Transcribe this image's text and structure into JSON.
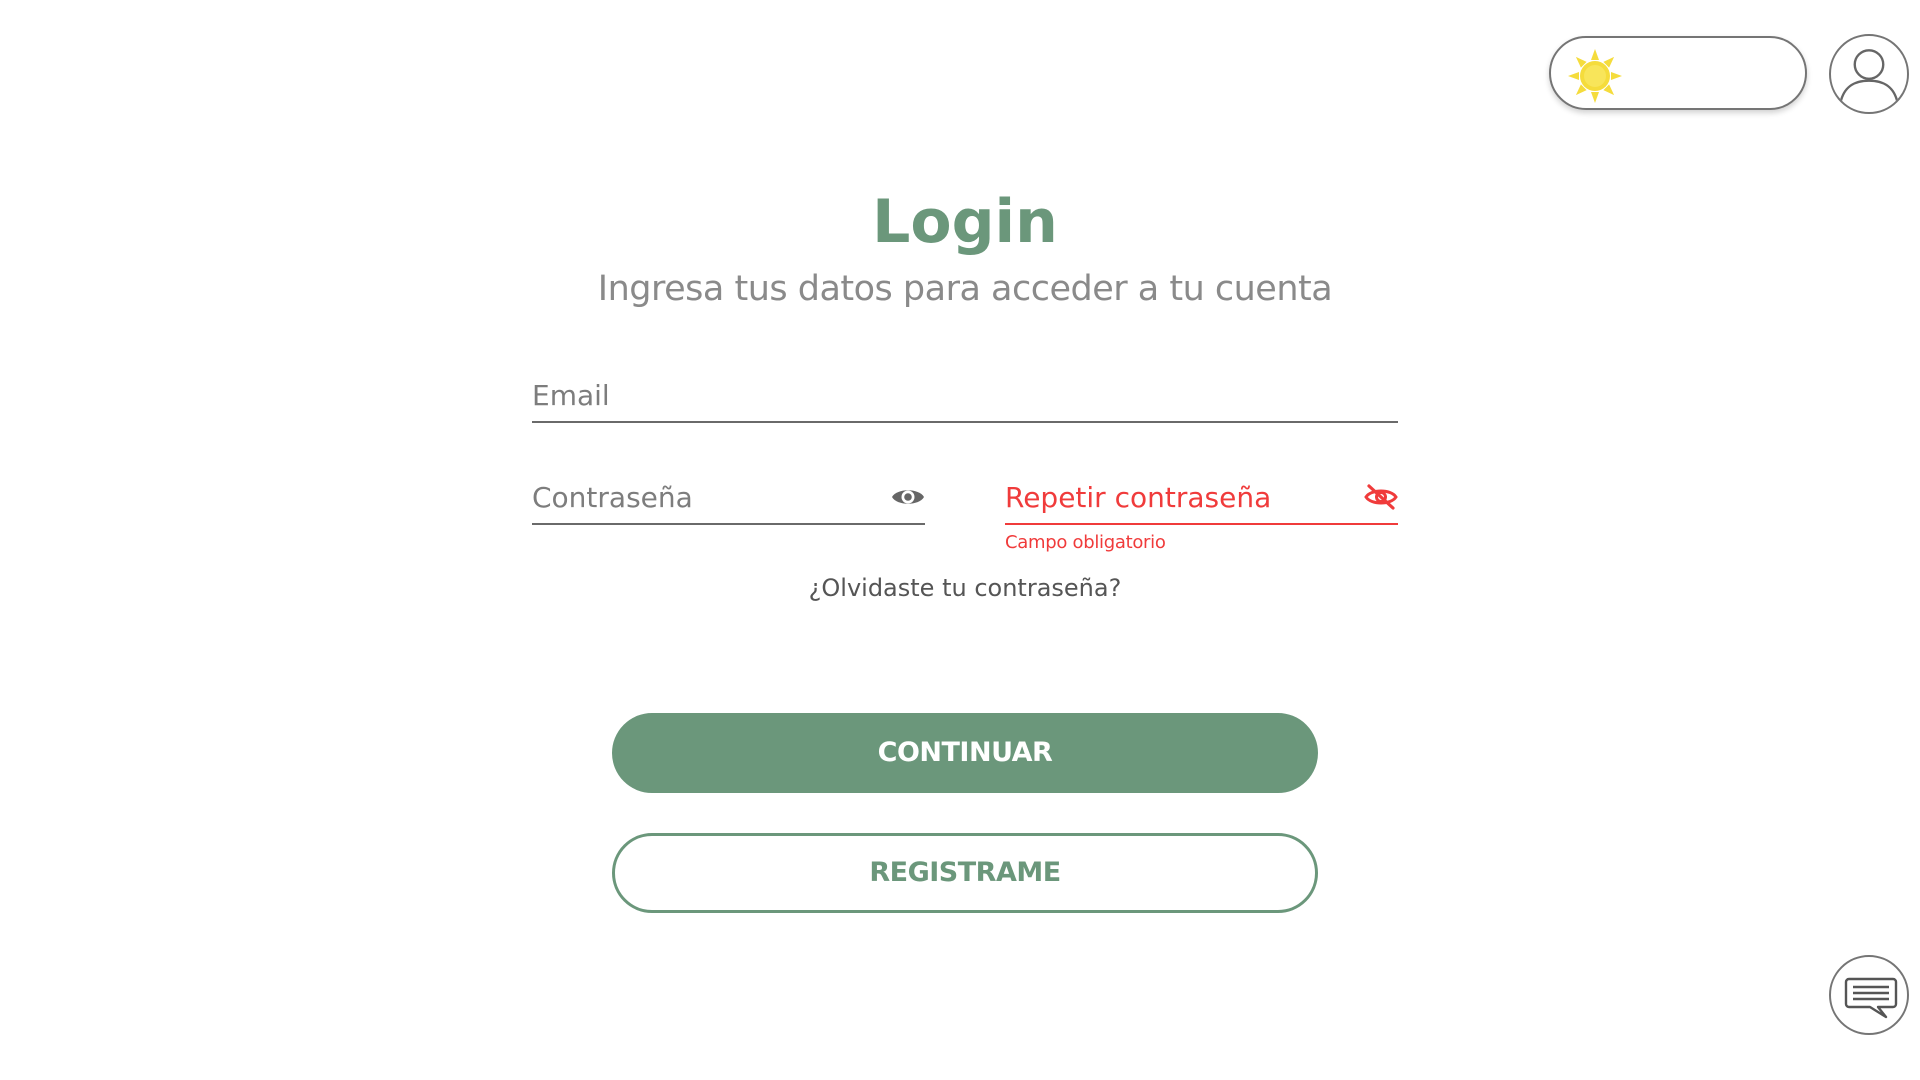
{
  "header": {
    "theme_toggle": {
      "mode": "light",
      "icon": "sun-icon"
    },
    "account": {
      "icon": "user-icon"
    }
  },
  "login": {
    "title": "Login",
    "subtitle": "Ingresa tus datos para acceder a tu cuenta",
    "email": {
      "placeholder": "Email",
      "value": ""
    },
    "password": {
      "placeholder": "Contraseña",
      "value": "",
      "icon": "eye-icon"
    },
    "repeat_password": {
      "placeholder": "Repetir contraseña",
      "value": "",
      "icon": "eye-off-icon",
      "error": "Campo obligatorio"
    },
    "forgot_link": "¿Olvidaste tu contraseña?",
    "continue_label": "CONTINUAR",
    "register_label": "REGISTRAME"
  },
  "chat": {
    "icon": "chat-icon"
  },
  "colors": {
    "accent": "#6b977b",
    "error": "#f03b3b",
    "sun": "#f5dc3c"
  }
}
